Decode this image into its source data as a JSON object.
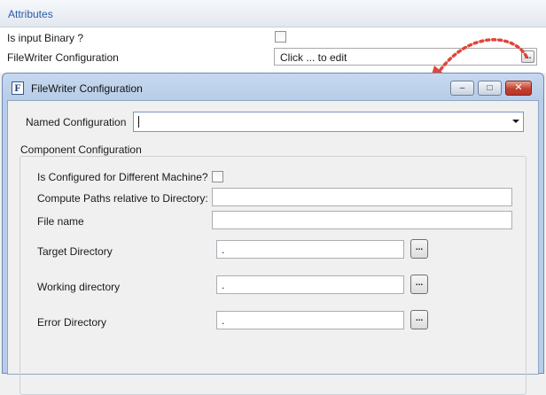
{
  "attributes": {
    "title": "Attributes",
    "rows": [
      {
        "label": "Is input Binary ?",
        "checked": false
      },
      {
        "label": "FileWriter Configuration",
        "value": "Click ... to edit",
        "button": "..."
      }
    ]
  },
  "dialog": {
    "icon_letter": "F",
    "title": "FileWriter Configuration",
    "controls": {
      "minimize": "–",
      "maximize": "□",
      "close": "✕"
    },
    "named_configuration": {
      "label": "Named Configuration",
      "value": ""
    },
    "component": {
      "legend": "Component Configuration",
      "different_machine": {
        "label": "Is Configured for Different Machine?",
        "checked": false
      },
      "compute_paths": {
        "label": "Compute Paths relative to Directory:",
        "value": ""
      },
      "file_name": {
        "label": "File name",
        "value": ""
      },
      "target_directory": {
        "label": "Target Directory",
        "value": ".",
        "button": "..."
      },
      "working_directory": {
        "label": "Working directory",
        "value": ".",
        "button": "..."
      },
      "error_directory": {
        "label": "Error Directory",
        "value": ".",
        "button": "..."
      }
    }
  },
  "colors": {
    "header_text": "#2a5aa8",
    "dialog_frame": "#b9cde8",
    "close_button": "#c2402f",
    "annotation_arrow": "#e0463a"
  }
}
